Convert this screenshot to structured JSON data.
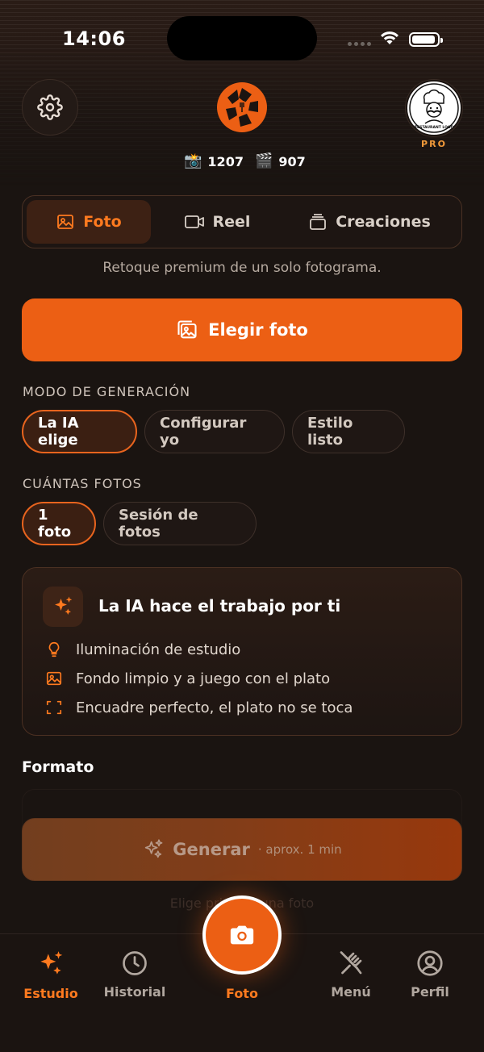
{
  "status_bar": {
    "time": "14:06"
  },
  "header": {
    "settings_icon": "gear-icon",
    "logo_icon": "aperture-fork-logo",
    "avatar_text": "RESTAURANT LOGO",
    "badge": "PRO",
    "counters": [
      {
        "icon": "📸",
        "value": "1207"
      },
      {
        "icon": "🎬",
        "value": "907"
      }
    ]
  },
  "tabs": [
    {
      "label": "Foto",
      "icon": "image-icon",
      "active": true
    },
    {
      "label": "Reel",
      "icon": "video-icon",
      "active": false
    },
    {
      "label": "Creaciones",
      "icon": "stack-icon",
      "active": false
    }
  ],
  "subtitle": "Retoque premium de un solo fotograma.",
  "primary_button": {
    "label": "Elegir foto",
    "icon": "gallery-icon"
  },
  "generation_mode": {
    "label": "MODO DE GENERACIÓN",
    "options": [
      "La IA elige",
      "Configurar yo",
      "Estilo listo"
    ],
    "selected": "La IA elige"
  },
  "photo_count": {
    "label": "CUÁNTAS FOTOS",
    "options": [
      "1 foto",
      "Sesión de fotos"
    ],
    "selected": "1 foto"
  },
  "ai_card": {
    "title": "La IA hace el trabajo por ti",
    "features": [
      {
        "icon": "lightbulb-icon",
        "text": "Iluminación de estudio"
      },
      {
        "icon": "image-icon",
        "text": "Fondo limpio y a juego con el plato"
      },
      {
        "icon": "frame-icon",
        "text": "Encuadre perfecto, el plato no se toca"
      }
    ]
  },
  "format_label": "Formato",
  "generate": {
    "label": "Generar",
    "sub": "· aprox. 1 min",
    "hint": "Elige primero una foto"
  },
  "accent": "#ec5f14",
  "bottom_nav": [
    {
      "label": "Estudio",
      "icon": "sparkles-icon",
      "active": true
    },
    {
      "label": "Historial",
      "icon": "clock-icon",
      "active": false
    },
    {
      "label": "Foto",
      "icon": "camera-icon",
      "active": false
    },
    {
      "label": "Menú",
      "icon": "utensils-icon",
      "active": false
    },
    {
      "label": "Perfil",
      "icon": "user-icon",
      "active": false
    }
  ]
}
